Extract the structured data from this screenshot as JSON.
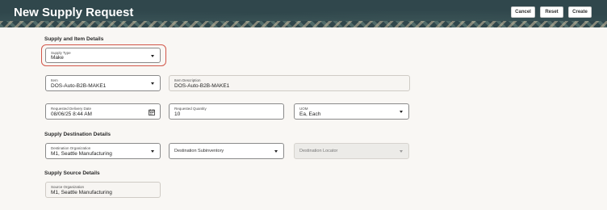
{
  "header": {
    "title": "New Supply Request",
    "buttons": {
      "cancel": "Cancel",
      "reset": "Reset",
      "create": "Create"
    }
  },
  "sections": {
    "supply_item": "Supply and Item Details",
    "destination": "Supply Destination Details",
    "source": "Supply Source Details"
  },
  "fields": {
    "supply_type": {
      "label": "Supply Type",
      "value": "Make"
    },
    "item": {
      "label": "Item",
      "value": "DOS-Auto-B2B-MAKE1"
    },
    "item_description": {
      "label": "Item Description",
      "value": "DOS-Auto-B2B-MAKE1"
    },
    "requested_delivery_date": {
      "label": "Requested Delivery Date",
      "value": "08/06/25 8:44 AM"
    },
    "requested_quantity": {
      "label": "Requested Quantity",
      "value": "10"
    },
    "uom": {
      "label": "UOM",
      "value": "Ea, Each"
    },
    "destination_organization": {
      "label": "Destination Organization",
      "value": "M1, Seattle Manufacturing"
    },
    "destination_subinventory": {
      "label": "Destination Subinventory",
      "value": ""
    },
    "destination_locator": {
      "label": "Destination Locator",
      "value": ""
    },
    "source_organization": {
      "label": "Source Organization",
      "value": "M1, Seattle Manufacturing"
    }
  },
  "icons": {
    "dropdown": "chevron-down-icon",
    "calendar": "calendar-icon"
  },
  "colors": {
    "header_bg": "#30474c",
    "focus_ring": "#d2574a",
    "content_bg": "#f9f7f4"
  }
}
